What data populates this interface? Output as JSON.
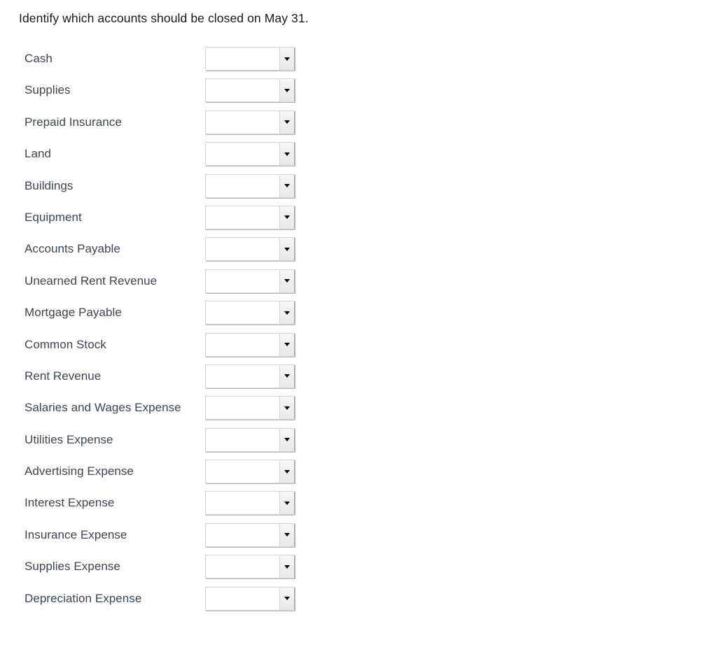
{
  "page": {
    "background_color": "#ffffff",
    "text_color": "#14181d",
    "label_color": "#3b4654"
  },
  "prompt": {
    "text": "Identify which accounts should be closed on May 31."
  },
  "form": {
    "dropdown_icon": "chevron-down-icon",
    "dropdown_selected_value": "",
    "dropdown_placeholder": "",
    "rows": [
      {
        "label": "Cash",
        "value": ""
      },
      {
        "label": "Supplies",
        "value": ""
      },
      {
        "label": "Prepaid Insurance",
        "value": ""
      },
      {
        "label": "Land",
        "value": ""
      },
      {
        "label": "Buildings",
        "value": ""
      },
      {
        "label": "Equipment",
        "value": ""
      },
      {
        "label": "Accounts Payable",
        "value": ""
      },
      {
        "label": "Unearned Rent Revenue",
        "value": ""
      },
      {
        "label": "Mortgage Payable",
        "value": ""
      },
      {
        "label": "Common Stock",
        "value": ""
      },
      {
        "label": "Rent Revenue",
        "value": ""
      },
      {
        "label": "Salaries and Wages Expense",
        "value": ""
      },
      {
        "label": "Utilities Expense",
        "value": ""
      },
      {
        "label": "Advertising Expense",
        "value": ""
      },
      {
        "label": "Interest Expense",
        "value": ""
      },
      {
        "label": "Insurance Expense",
        "value": ""
      },
      {
        "label": "Supplies Expense",
        "value": ""
      },
      {
        "label": "Depreciation Expense",
        "value": ""
      }
    ]
  }
}
